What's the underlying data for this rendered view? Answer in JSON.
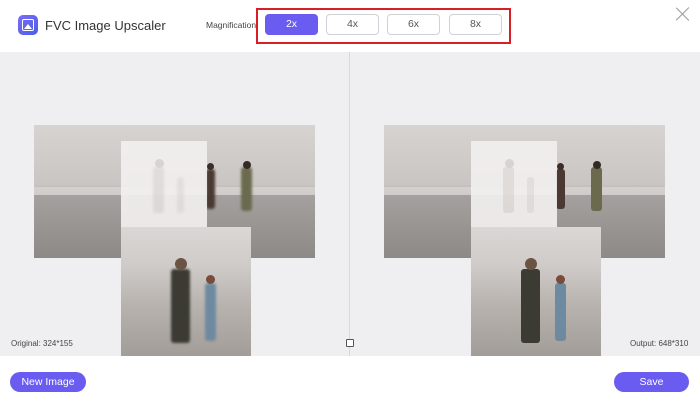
{
  "app": {
    "title": "FVC Image Upscaler",
    "logo_icon": "upscale-image-icon"
  },
  "magnification": {
    "label": "Magnification:",
    "options": [
      "2x",
      "4x",
      "6x",
      "8x"
    ],
    "selected": "2x"
  },
  "status": {
    "original": "Original: 324*155",
    "output": "Output: 648*310"
  },
  "footer": {
    "new_image": "New Image",
    "save": "Save"
  },
  "colors": {
    "accent": "#6a5cf0",
    "highlight": "#d81f26"
  }
}
